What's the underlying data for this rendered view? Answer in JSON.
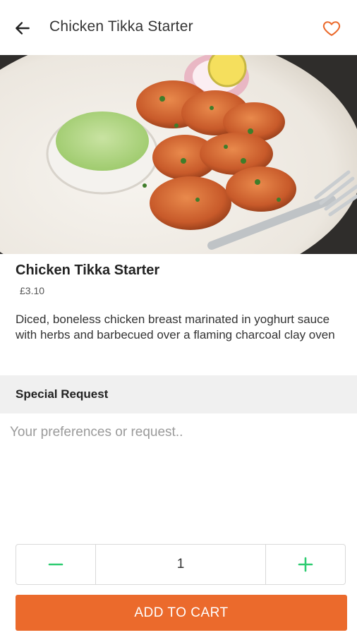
{
  "header": {
    "title": "Chicken Tikka Starter",
    "back_icon": "arrow-left-icon",
    "favorite_icon": "heart-outline-icon",
    "accent_color": "#eb6a2c"
  },
  "product": {
    "image_icon": "food-photo",
    "name": "Chicken Tikka Starter",
    "price": "£3.10",
    "description": "Diced, boneless chicken breast marinated in yoghurt sauce with herbs and barbecued over a flaming charcoal clay oven"
  },
  "special_request": {
    "heading": "Special Request",
    "placeholder": "Your preferences or request.."
  },
  "quantity": {
    "value": "1",
    "minus_icon": "minus-icon",
    "plus_icon": "plus-icon",
    "stepper_color": "#2ecc71"
  },
  "cart": {
    "button_label": "ADD TO CART",
    "button_color": "#eb6a2c"
  }
}
